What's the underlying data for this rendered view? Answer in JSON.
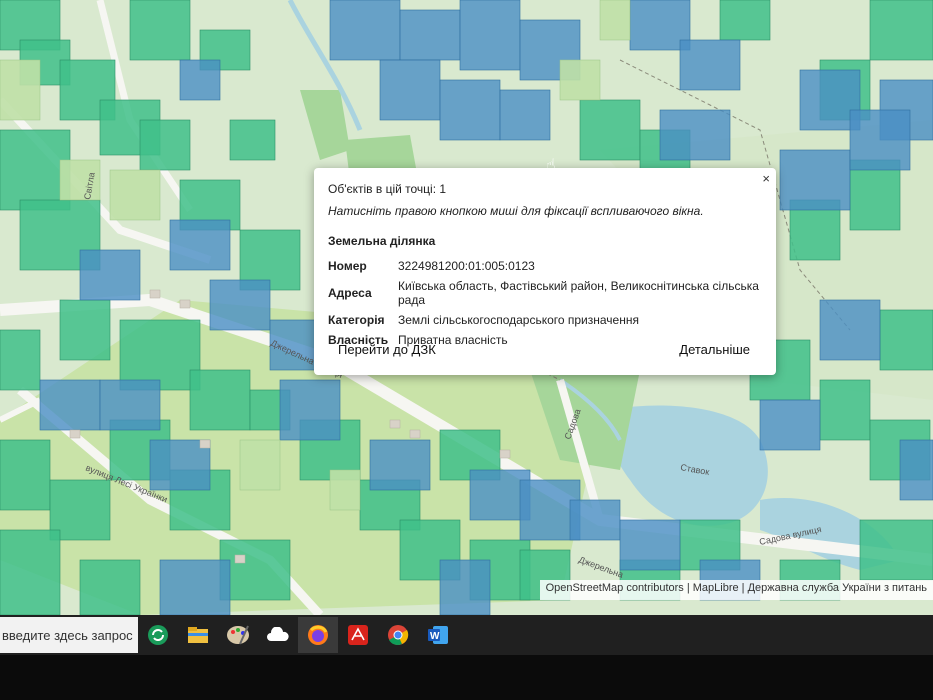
{
  "popup": {
    "objects_count": "Об'єктів в цій точці: 1",
    "hint": "Натисніть правою кнопкою миші для фіксації вспливаючого вікна.",
    "section_title": "Земельна ділянка",
    "rows": [
      {
        "key": "Номер",
        "value": "3224981200:01:005:0123"
      },
      {
        "key": "Адреса",
        "value": "Київська область, Фастівський район, Великоснітинська сільська рада"
      },
      {
        "key": "Категорія",
        "value": "Землі сільськогосподарського призначення"
      },
      {
        "key": "Власність",
        "value": "Приватна власність"
      }
    ],
    "link_dzk": "Перейти до ДЗК",
    "link_details": "Детальніше",
    "close": "×"
  },
  "map": {
    "attribution": "OpenStreetMap contributors | MapLibre | Державна служба України з питань",
    "street_labels": [
      "Джерельна вулиця",
      "вулиця Лесі Українки",
      "Садова",
      "Джерельна",
      "Садова вулиця",
      "Ставок",
      "Світла"
    ]
  },
  "taskbar": {
    "search_text": "введите здесь запрос",
    "apps": [
      "sync-icon",
      "file-explorer-icon",
      "paint-icon",
      "cloud-icon",
      "firefox-icon",
      "acrobat-icon",
      "chrome-icon",
      "word-icon"
    ]
  },
  "colors": {
    "parcel_green": "#3fbf8a",
    "parcel_blue": "#4a8fc4",
    "parcel_light": "#bfe0a6",
    "water": "#aad3df",
    "road": "#f4f4f0"
  }
}
